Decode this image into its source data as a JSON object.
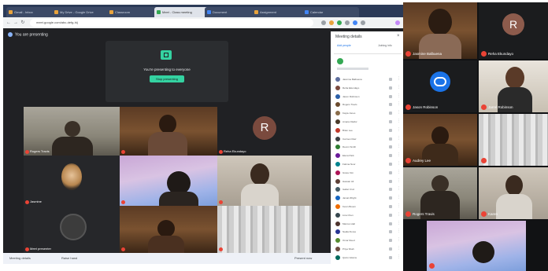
{
  "browser": {
    "tabs": [
      {
        "label": "Gmail - Inbox",
        "active": false
      },
      {
        "label": "My Drive - Google Drive",
        "active": false
      },
      {
        "label": "Classroom",
        "active": false
      },
      {
        "label": "Meet - Class meeting",
        "active": true
      },
      {
        "label": "Document",
        "active": false
      },
      {
        "label": "Assignment",
        "active": false
      },
      {
        "label": "Calendar",
        "active": false
      }
    ],
    "url": "meet.google.com/abc-defg-hij"
  },
  "meet": {
    "title": "You are presenting",
    "present_card": {
      "message": "You're presenting to everyone",
      "stop_label": "Stop presenting"
    },
    "tiles": [
      {
        "name": "Rogers Travis",
        "style": "room"
      },
      {
        "name": "",
        "style": "warm"
      },
      {
        "name": "Reha Ekundayo",
        "style": "initial",
        "initial": "R",
        "color": "#7a4a3e"
      },
      {
        "name": "Jasmine",
        "style": "dark"
      },
      {
        "name": "",
        "style": "sky"
      },
      {
        "name": "",
        "style": "room"
      },
      {
        "name": "Meet presenter",
        "style": "dark"
      },
      {
        "name": "",
        "style": "warm"
      },
      {
        "name": "",
        "style": "curtain"
      }
    ],
    "bottom": {
      "meeting_details": "Meeting details",
      "raise_hand": "Raise hand",
      "present": "Present now"
    }
  },
  "panel": {
    "title": "Meeting details",
    "add_people": "Add people",
    "join_info": "Joining info",
    "participants": [
      {
        "name": "Jasmine Balbuena",
        "color": "#5f6f9e"
      },
      {
        "name": "Reha Ekundayo",
        "color": "#7a4a3e"
      },
      {
        "name": "Jason Robinson",
        "color": "#2b5fa8"
      },
      {
        "name": "Rogers Travis",
        "color": "#6b4b2e"
      },
      {
        "name": "Kayla Jones",
        "color": "#8a6d4b"
      },
      {
        "name": "Amara Okafor",
        "color": "#4a3a2a"
      },
      {
        "name": "Brian Lee",
        "color": "#c0392b"
      },
      {
        "name": "Carmen Diaz",
        "color": "#3c4043"
      },
      {
        "name": "Devon Smith",
        "color": "#2e7d32"
      },
      {
        "name": "Elena Park",
        "color": "#6a1b9a"
      },
      {
        "name": "Fatima Noor",
        "color": "#00838f"
      },
      {
        "name": "Grace Kim",
        "color": "#ad1457"
      },
      {
        "name": "Hassan Ali",
        "color": "#5d4037"
      },
      {
        "name": "Isabel Cruz",
        "color": "#455a64"
      },
      {
        "name": "Jamal Wright",
        "color": "#1565c0"
      },
      {
        "name": "Kevin Brown",
        "color": "#ef6c00"
      },
      {
        "name": "Lina Chen",
        "color": "#37474f"
      },
      {
        "name": "Marcus Hall",
        "color": "#4e342e"
      },
      {
        "name": "Nadia Flores",
        "color": "#283593"
      },
      {
        "name": "Omar Reed",
        "color": "#558b2f"
      },
      {
        "name": "Priya Shah",
        "color": "#6d4c41"
      },
      {
        "name": "Quinn Adams",
        "color": "#00695c"
      }
    ]
  },
  "phone": {
    "tiles": [
      {
        "name": "Jasmine Balbuena",
        "style": "warm"
      },
      {
        "name": "Reha Ekundayo",
        "style": "initial",
        "initial": "R",
        "color": "#8d5b4c"
      },
      {
        "name": "Jason Robinson",
        "style": "logo"
      },
      {
        "name": "Jarrel Robinson",
        "style": "room"
      },
      {
        "name": "Audrey Lee",
        "style": "warm"
      },
      {
        "name": "",
        "style": "curtain"
      },
      {
        "name": "Rogers Travis",
        "style": "room"
      },
      {
        "name": "Karen",
        "style": "room"
      },
      {
        "name": "",
        "style": "sky"
      }
    ]
  },
  "colors": {
    "meet_bg": "#202124",
    "accent": "#34d2a1",
    "mic_off": "#ea4335",
    "tabbar": "#2b3a57"
  }
}
